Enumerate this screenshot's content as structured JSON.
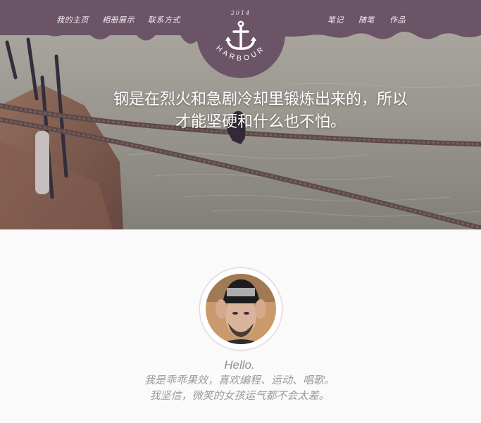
{
  "nav": {
    "left": [
      {
        "label": "我的主页"
      },
      {
        "label": "相册展示"
      },
      {
        "label": "联系方式"
      }
    ],
    "right": [
      {
        "label": "笔记"
      },
      {
        "label": "随笔"
      },
      {
        "label": "作品"
      }
    ]
  },
  "logo": {
    "year": "2014",
    "name": "HARBOUR",
    "icon": "anchor-icon"
  },
  "hero": {
    "quote_line1": "钢是在烈火和急剧冷却里锻炼出来的，所以",
    "quote_line2": "才能坚硬和什么也不怕。"
  },
  "profile": {
    "avatar": "avatar-photo",
    "greeting": "Hello.",
    "bio_line1": "我是乖乖果效，喜欢编程、运动、唱歌。",
    "bio_line2": "我坚信，微笑的女孩运气都不会太差。"
  },
  "colors": {
    "band": "#6b5466",
    "quote_text": "#ffffff",
    "page_bg": "#fafafa",
    "bio_text": "#9a9a9a"
  }
}
